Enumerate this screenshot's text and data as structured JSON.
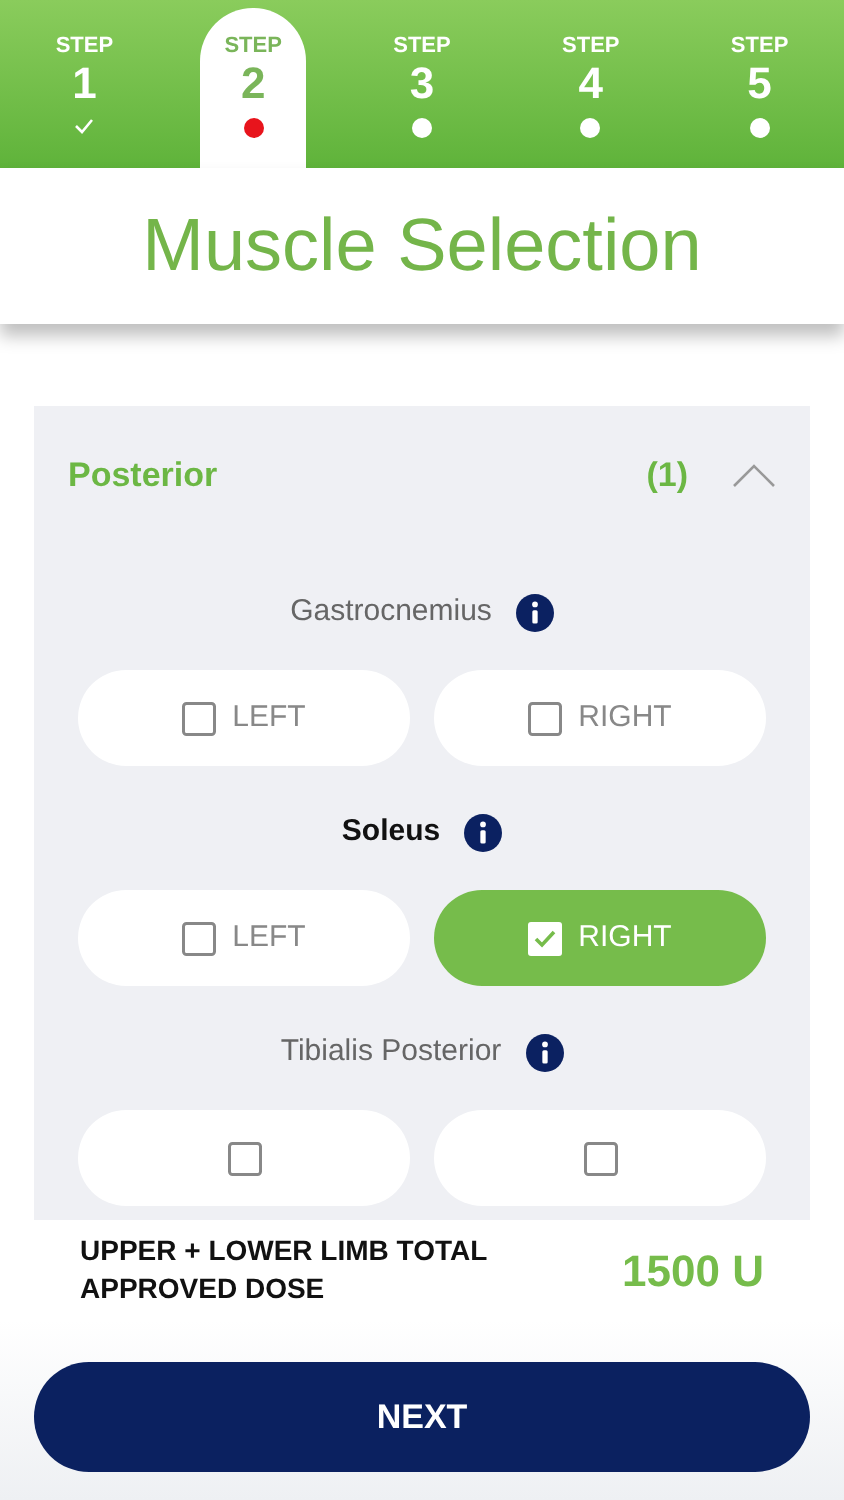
{
  "steps": [
    {
      "label": "STEP",
      "number": "1",
      "completed": true,
      "selected": false
    },
    {
      "label": "STEP",
      "number": "2",
      "completed": false,
      "selected": true
    },
    {
      "label": "STEP",
      "number": "3",
      "completed": false,
      "selected": false
    },
    {
      "label": "STEP",
      "number": "4",
      "completed": false,
      "selected": false
    },
    {
      "label": "STEP",
      "number": "5",
      "completed": false,
      "selected": false
    }
  ],
  "title": "Muscle Selection",
  "section": {
    "title": "Posterior",
    "count": "(1)",
    "expanded": true,
    "muscles": [
      {
        "name": "Gastrocnemius",
        "selected": false,
        "options": [
          {
            "label": "LEFT",
            "checked": false
          },
          {
            "label": "RIGHT",
            "checked": false
          }
        ]
      },
      {
        "name": "Soleus",
        "selected": true,
        "options": [
          {
            "label": "LEFT",
            "checked": false
          },
          {
            "label": "RIGHT",
            "checked": true
          }
        ]
      },
      {
        "name": "Tibialis Posterior",
        "selected": false,
        "options": [
          {
            "checked": false
          },
          {
            "checked": false
          }
        ]
      }
    ]
  },
  "dose": {
    "label": "UPPER + LOWER LIMB TOTAL APPROVED DOSE",
    "value": "1500 U"
  },
  "next_button": "NEXT"
}
